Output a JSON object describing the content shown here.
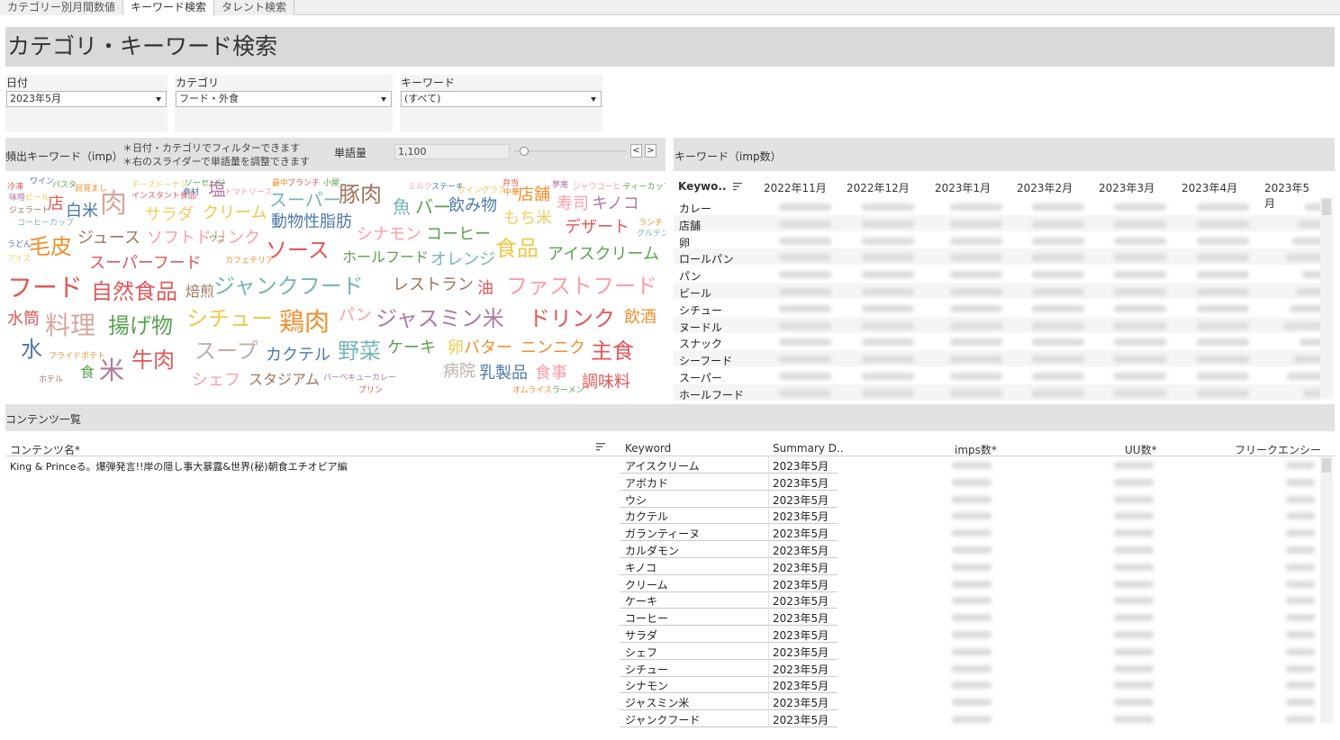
{
  "tabs": [
    "カテゴリー別月間数値",
    "キーワード検索",
    "タレント検索"
  ],
  "active_tab": 1,
  "page_title": "カテゴリ・キーワード検索",
  "filters": {
    "date": {
      "label": "日付",
      "value": "2023年5月"
    },
    "category": {
      "label": "カテゴリ",
      "value": "フード・外食"
    },
    "keyword": {
      "label": "キーワード",
      "value": "(すべて)"
    }
  },
  "wordcloud_section": {
    "title": "頻出キーワード（imp）",
    "note1": "＊日付・カテゴリでフィルターできます",
    "note2": "＊右のスライダーで単語量を調整できます",
    "slider_label": "単語量",
    "slider_value": "1,100",
    "slider_position": 0.1,
    "prev_glyph": "<",
    "next_glyph": ">"
  },
  "wordcloud": {
    "words": [
      {
        "text": "冷凍",
        "color": "#e15759"
      },
      {
        "text": "ワイン",
        "color": "#4e79a7"
      },
      {
        "text": "パスタ",
        "color": "#59a14f"
      },
      {
        "text": "目覚まし",
        "color": "#f28e2b"
      },
      {
        "text": "味噌",
        "color": "#b07aa1"
      },
      {
        "text": "ビール",
        "color": "#edc948"
      },
      {
        "text": "店",
        "color": "#e15759"
      },
      {
        "text": "白米",
        "color": "#4e79a7"
      },
      {
        "text": "肉",
        "color": "#d4a6a0"
      },
      {
        "text": "ジェラート",
        "color": "#9c755f"
      },
      {
        "text": "コーヒーカップ",
        "color": "#76b7b2"
      },
      {
        "text": "チーズドーナツ",
        "color": "#f1ce63"
      },
      {
        "text": "インスタント食品",
        "color": "#e15759"
      },
      {
        "text": "食材",
        "color": "#4e79a7"
      },
      {
        "text": "塩",
        "color": "#b07aa1"
      },
      {
        "text": "ソーセージ",
        "color": "#59a14f"
      },
      {
        "text": "トマトソース",
        "color": "#ff9da7"
      },
      {
        "text": "サラダ",
        "color": "#f1ce63"
      },
      {
        "text": "クリーム",
        "color": "#edc948"
      },
      {
        "text": "スーパー",
        "color": "#76b7b2"
      },
      {
        "text": "豚肉",
        "color": "#9c755f"
      },
      {
        "text": "動物性脂肪",
        "color": "#4e79a7"
      },
      {
        "text": "最中",
        "color": "#f28e2b"
      },
      {
        "text": "ブランチ",
        "color": "#e15759"
      },
      {
        "text": "小屋",
        "color": "#59a14f"
      },
      {
        "text": "ミルク",
        "color": "#ff9da7"
      },
      {
        "text": "ステーキ",
        "color": "#4e79a7"
      },
      {
        "text": "ウイングラス",
        "color": "#edc948"
      },
      {
        "text": "魚",
        "color": "#76b7b2"
      },
      {
        "text": "バー",
        "color": "#59a14f"
      },
      {
        "text": "飲み物",
        "color": "#4e79a7"
      },
      {
        "text": "弁当",
        "color": "#e15759"
      },
      {
        "text": "中華",
        "color": "#f28e2b"
      },
      {
        "text": "店舗",
        "color": "#f28e2b"
      },
      {
        "text": "夢庵",
        "color": "#b07aa1"
      },
      {
        "text": "寿司",
        "color": "#ff9da7"
      },
      {
        "text": "キノコ",
        "color": "#b07aa1"
      },
      {
        "text": "ジャワコーヒー",
        "color": "#ff9da7"
      },
      {
        "text": "ティーカップ",
        "color": "#59a14f"
      },
      {
        "text": "もち米",
        "color": "#f1ce63"
      },
      {
        "text": "デザート",
        "color": "#e15759"
      },
      {
        "text": "ランチ",
        "color": "#f28e2b"
      },
      {
        "text": "グルテン",
        "color": "#76b7b2"
      },
      {
        "text": "うどん",
        "color": "#4e79a7"
      },
      {
        "text": "毛皮",
        "color": "#f28e2b"
      },
      {
        "text": "ジュース",
        "color": "#9c755f"
      },
      {
        "text": "ソフトドリンク",
        "color": "#ff9da7"
      },
      {
        "text": "ウニ",
        "color": "#59a14f"
      },
      {
        "text": "シナモン",
        "color": "#ff9da7"
      },
      {
        "text": "コーヒー",
        "color": "#59a14f"
      },
      {
        "text": "食品",
        "color": "#edc948"
      },
      {
        "text": "アイスクリーム",
        "color": "#59a14f"
      },
      {
        "text": "アイス",
        "color": "#f1ce63"
      },
      {
        "text": "スーパーフード",
        "color": "#e15759"
      },
      {
        "text": "カフェテリア",
        "color": "#f28e2b"
      },
      {
        "text": "ソース",
        "color": "#e15759"
      },
      {
        "text": "ホールフード",
        "color": "#59a14f"
      },
      {
        "text": "オレンジ",
        "color": "#76b7b2"
      },
      {
        "text": "フード",
        "color": "#e15759"
      },
      {
        "text": "自然食品",
        "color": "#e15759"
      },
      {
        "text": "焙煎",
        "color": "#9c755f"
      },
      {
        "text": "ジャンクフード",
        "color": "#76b7b2"
      },
      {
        "text": "レストラン",
        "color": "#9c755f"
      },
      {
        "text": "油",
        "color": "#e15759"
      },
      {
        "text": "ファストフード",
        "color": "#ff9da7"
      },
      {
        "text": "水筒",
        "color": "#e15759"
      },
      {
        "text": "料理",
        "color": "#d4a6a0"
      },
      {
        "text": "揚げ物",
        "color": "#59a14f"
      },
      {
        "text": "シチュー",
        "color": "#edc948"
      },
      {
        "text": "鶏肉",
        "color": "#f28e2b"
      },
      {
        "text": "パン",
        "color": "#ff9da7"
      },
      {
        "text": "ジャスミン米",
        "color": "#b07aa1"
      },
      {
        "text": "ドリンク",
        "color": "#e15759"
      },
      {
        "text": "飲酒",
        "color": "#f28e2b"
      },
      {
        "text": "水",
        "color": "#4e79a7"
      },
      {
        "text": "スープ",
        "color": "#bab0ac"
      },
      {
        "text": "カクテル",
        "color": "#4e79a7"
      },
      {
        "text": "野菜",
        "color": "#76b7b2"
      },
      {
        "text": "ケーキ",
        "color": "#59a14f"
      },
      {
        "text": "卵",
        "color": "#edc948"
      },
      {
        "text": "バター",
        "color": "#f28e2b"
      },
      {
        "text": "ニンニク",
        "color": "#f28e2b"
      },
      {
        "text": "主食",
        "color": "#e15759"
      },
      {
        "text": "米",
        "color": "#b07aa1"
      },
      {
        "text": "牛肉",
        "color": "#e15759"
      },
      {
        "text": "食",
        "color": "#59a14f"
      },
      {
        "text": "シェフ",
        "color": "#ff9da7"
      },
      {
        "text": "スタジアム",
        "color": "#9c755f"
      },
      {
        "text": "病院",
        "color": "#bab0ac"
      },
      {
        "text": "乳製品",
        "color": "#4e79a7"
      },
      {
        "text": "食事",
        "color": "#ff9da7"
      },
      {
        "text": "調味料",
        "color": "#e15759"
      },
      {
        "text": "フライドポテト",
        "color": "#f28e2b"
      },
      {
        "text": "ホテル",
        "color": "#9c755f"
      },
      {
        "text": "パーベキューカレー",
        "color": "#b07aa1"
      },
      {
        "text": "プリン",
        "color": "#e15759"
      },
      {
        "text": "オムライス",
        "color": "#f28e2b"
      },
      {
        "text": "ラーメン",
        "color": "#59a14f"
      }
    ]
  },
  "keyword_section": {
    "title": "キーワード（imp数）",
    "col_keyword": "Keywo..",
    "months": [
      "2022年11月",
      "2022年12月",
      "2023年1月",
      "2023年2月",
      "2023年3月",
      "2023年4月",
      "2023年5月"
    ],
    "rows": [
      "カレー",
      "店舗",
      "卵",
      "ロールパン",
      "パン",
      "ビール",
      "シチュー",
      "ヌードル",
      "スナック",
      "シーフード",
      "スーパー",
      "ホールフード"
    ]
  },
  "content_section": {
    "title": "コンテンツ一覧",
    "col_content": "コンテンツ名*",
    "col_keyword": "Keyword",
    "col_summary": "Summary D..",
    "col_imps": "imps数*",
    "col_uu": "UU数*",
    "col_freq": "フリークエンシー",
    "content_name": "King & Princeる。爆弾発言!!岸の隠し事大暴露&世界(秘)朝食エチオピア編",
    "rows": [
      {
        "keyword": "アイスクリーム",
        "date": "2023年5月"
      },
      {
        "keyword": "アボカド",
        "date": "2023年5月"
      },
      {
        "keyword": "ウシ",
        "date": "2023年5月"
      },
      {
        "keyword": "カクテル",
        "date": "2023年5月"
      },
      {
        "keyword": "ガランティーヌ",
        "date": "2023年5月"
      },
      {
        "keyword": "カルダモン",
        "date": "2023年5月"
      },
      {
        "keyword": "キノコ",
        "date": "2023年5月"
      },
      {
        "keyword": "クリーム",
        "date": "2023年5月"
      },
      {
        "keyword": "ケーキ",
        "date": "2023年5月"
      },
      {
        "keyword": "コーヒー",
        "date": "2023年5月"
      },
      {
        "keyword": "サラダ",
        "date": "2023年5月"
      },
      {
        "keyword": "シェフ",
        "date": "2023年5月"
      },
      {
        "keyword": "シチュー",
        "date": "2023年5月"
      },
      {
        "keyword": "シナモン",
        "date": "2023年5月"
      },
      {
        "keyword": "ジャスミン米",
        "date": "2023年5月"
      },
      {
        "keyword": "ジャンクフード",
        "date": "2023年5月"
      }
    ]
  }
}
